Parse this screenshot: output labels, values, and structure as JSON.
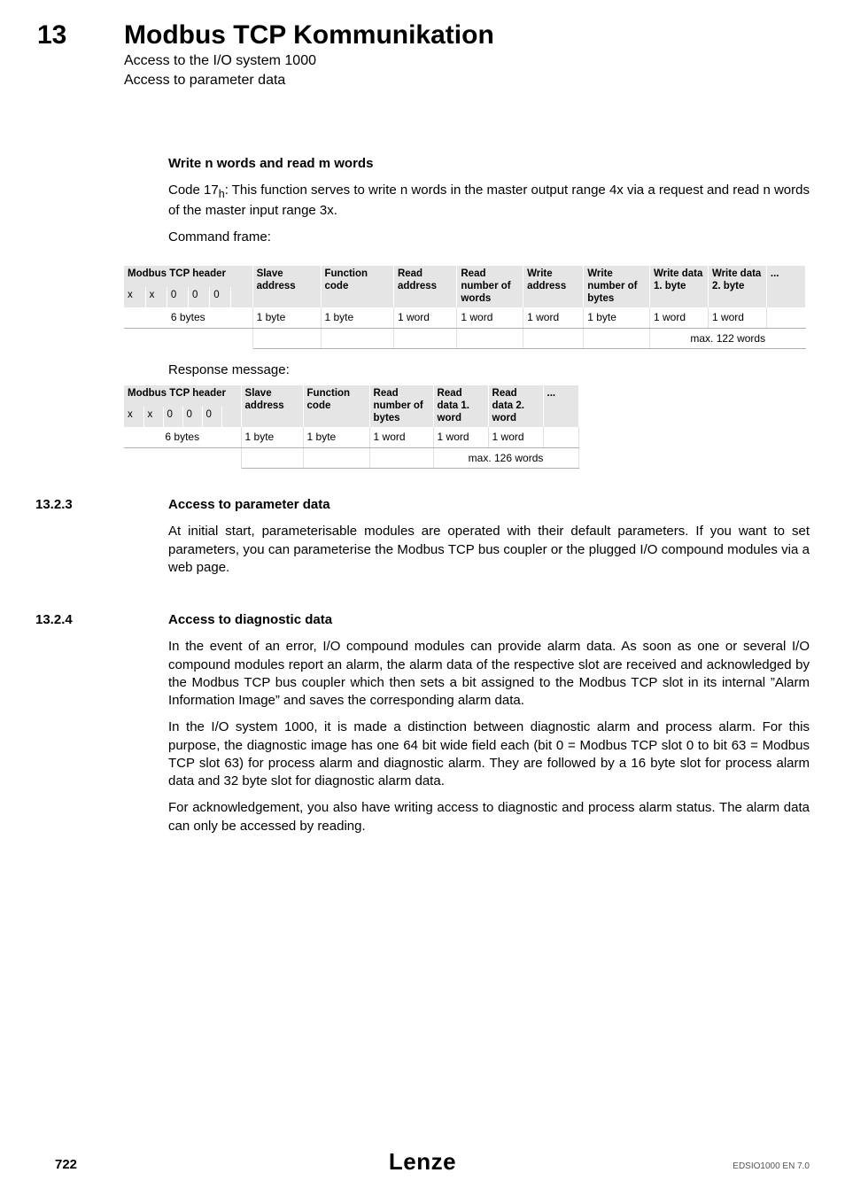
{
  "header": {
    "page_num_top": "13",
    "chapter_title": "Modbus TCP Kommunikation",
    "sub1": "Access to the I/O system 1000",
    "sub2": "Access to parameter data"
  },
  "s1": {
    "heading": "Write n words and read m words",
    "p1a": "Code 17",
    "p1_sub": "h",
    "p1b": ": This function serves to write n words in the master output range 4x via a request and read n words of the master input range 3x.",
    "cmd_label": "Command frame:",
    "t1": {
      "h_modbus": "Modbus TCP header",
      "h_slave": "Slave address",
      "h_func": "Function code",
      "h_raddr": "Read address",
      "h_rnum": "Read number of words",
      "h_waddr": "Write address",
      "h_wnum": "Write number of bytes",
      "h_d1": "Write data 1. byte",
      "h_d2": "Write data 2. byte",
      "h_dots": "...",
      "sub_x": "x",
      "sub_0": "0",
      "r1_bytes": "6 bytes",
      "r1_1b": "1 byte",
      "r1_1w": "1 word",
      "r2_max": "max. 122 words"
    },
    "resp_label": "Response message:",
    "t2": {
      "h_modbus": "Modbus TCP header",
      "h_slave": "Slave address",
      "h_func": "Function code",
      "h_rnum": "Read number of bytes",
      "h_d1": "Read data 1. word",
      "h_d2": "Read data 2. word",
      "h_dots": "...",
      "sub_x": "x",
      "sub_0": "0",
      "r1_bytes": "6 bytes",
      "r1_1b": "1 byte",
      "r1_1w": "1 word",
      "r2_max": "max. 126 words"
    }
  },
  "s2": {
    "num": "13.2.3",
    "heading": "Access to parameter data",
    "p1": "At initial start, parameterisable modules are operated with their default parameters. If you want to set parameters, you can parameterise the Modbus TCP bus coupler or the plugged I/O compound modules via a web page."
  },
  "s3": {
    "num": "13.2.4",
    "heading": "Access to diagnostic data",
    "p1": "In the event of an error, I/O compound modules can provide alarm data. As soon as one or several I/O compound modules report an alarm, the alarm data of the respective slot are received and acknowledged by the Modbus TCP bus coupler which then sets a bit assigned to the Modbus TCP slot in its internal ”Alarm Information Image” and saves the corresponding alarm data.",
    "p2": "In the I/O system 1000, it is made a distinction between diagnostic alarm and process alarm. For this purpose, the diagnostic image has one 64 bit wide field each (bit 0 = Modbus TCP slot 0 to bit 63 = Modbus TCP slot 63) for process alarm and diagnostic alarm. They are followed by a 16 byte slot for process alarm data and 32 byte slot for diagnostic alarm data.",
    "p3": "For acknowledgement, you also have writing access to diagnostic and process alarm status. The alarm data can only be accessed by reading."
  },
  "footer": {
    "page_num": "722",
    "doc_id": "EDSIO1000 EN 7.0",
    "logo": "Lenze"
  }
}
